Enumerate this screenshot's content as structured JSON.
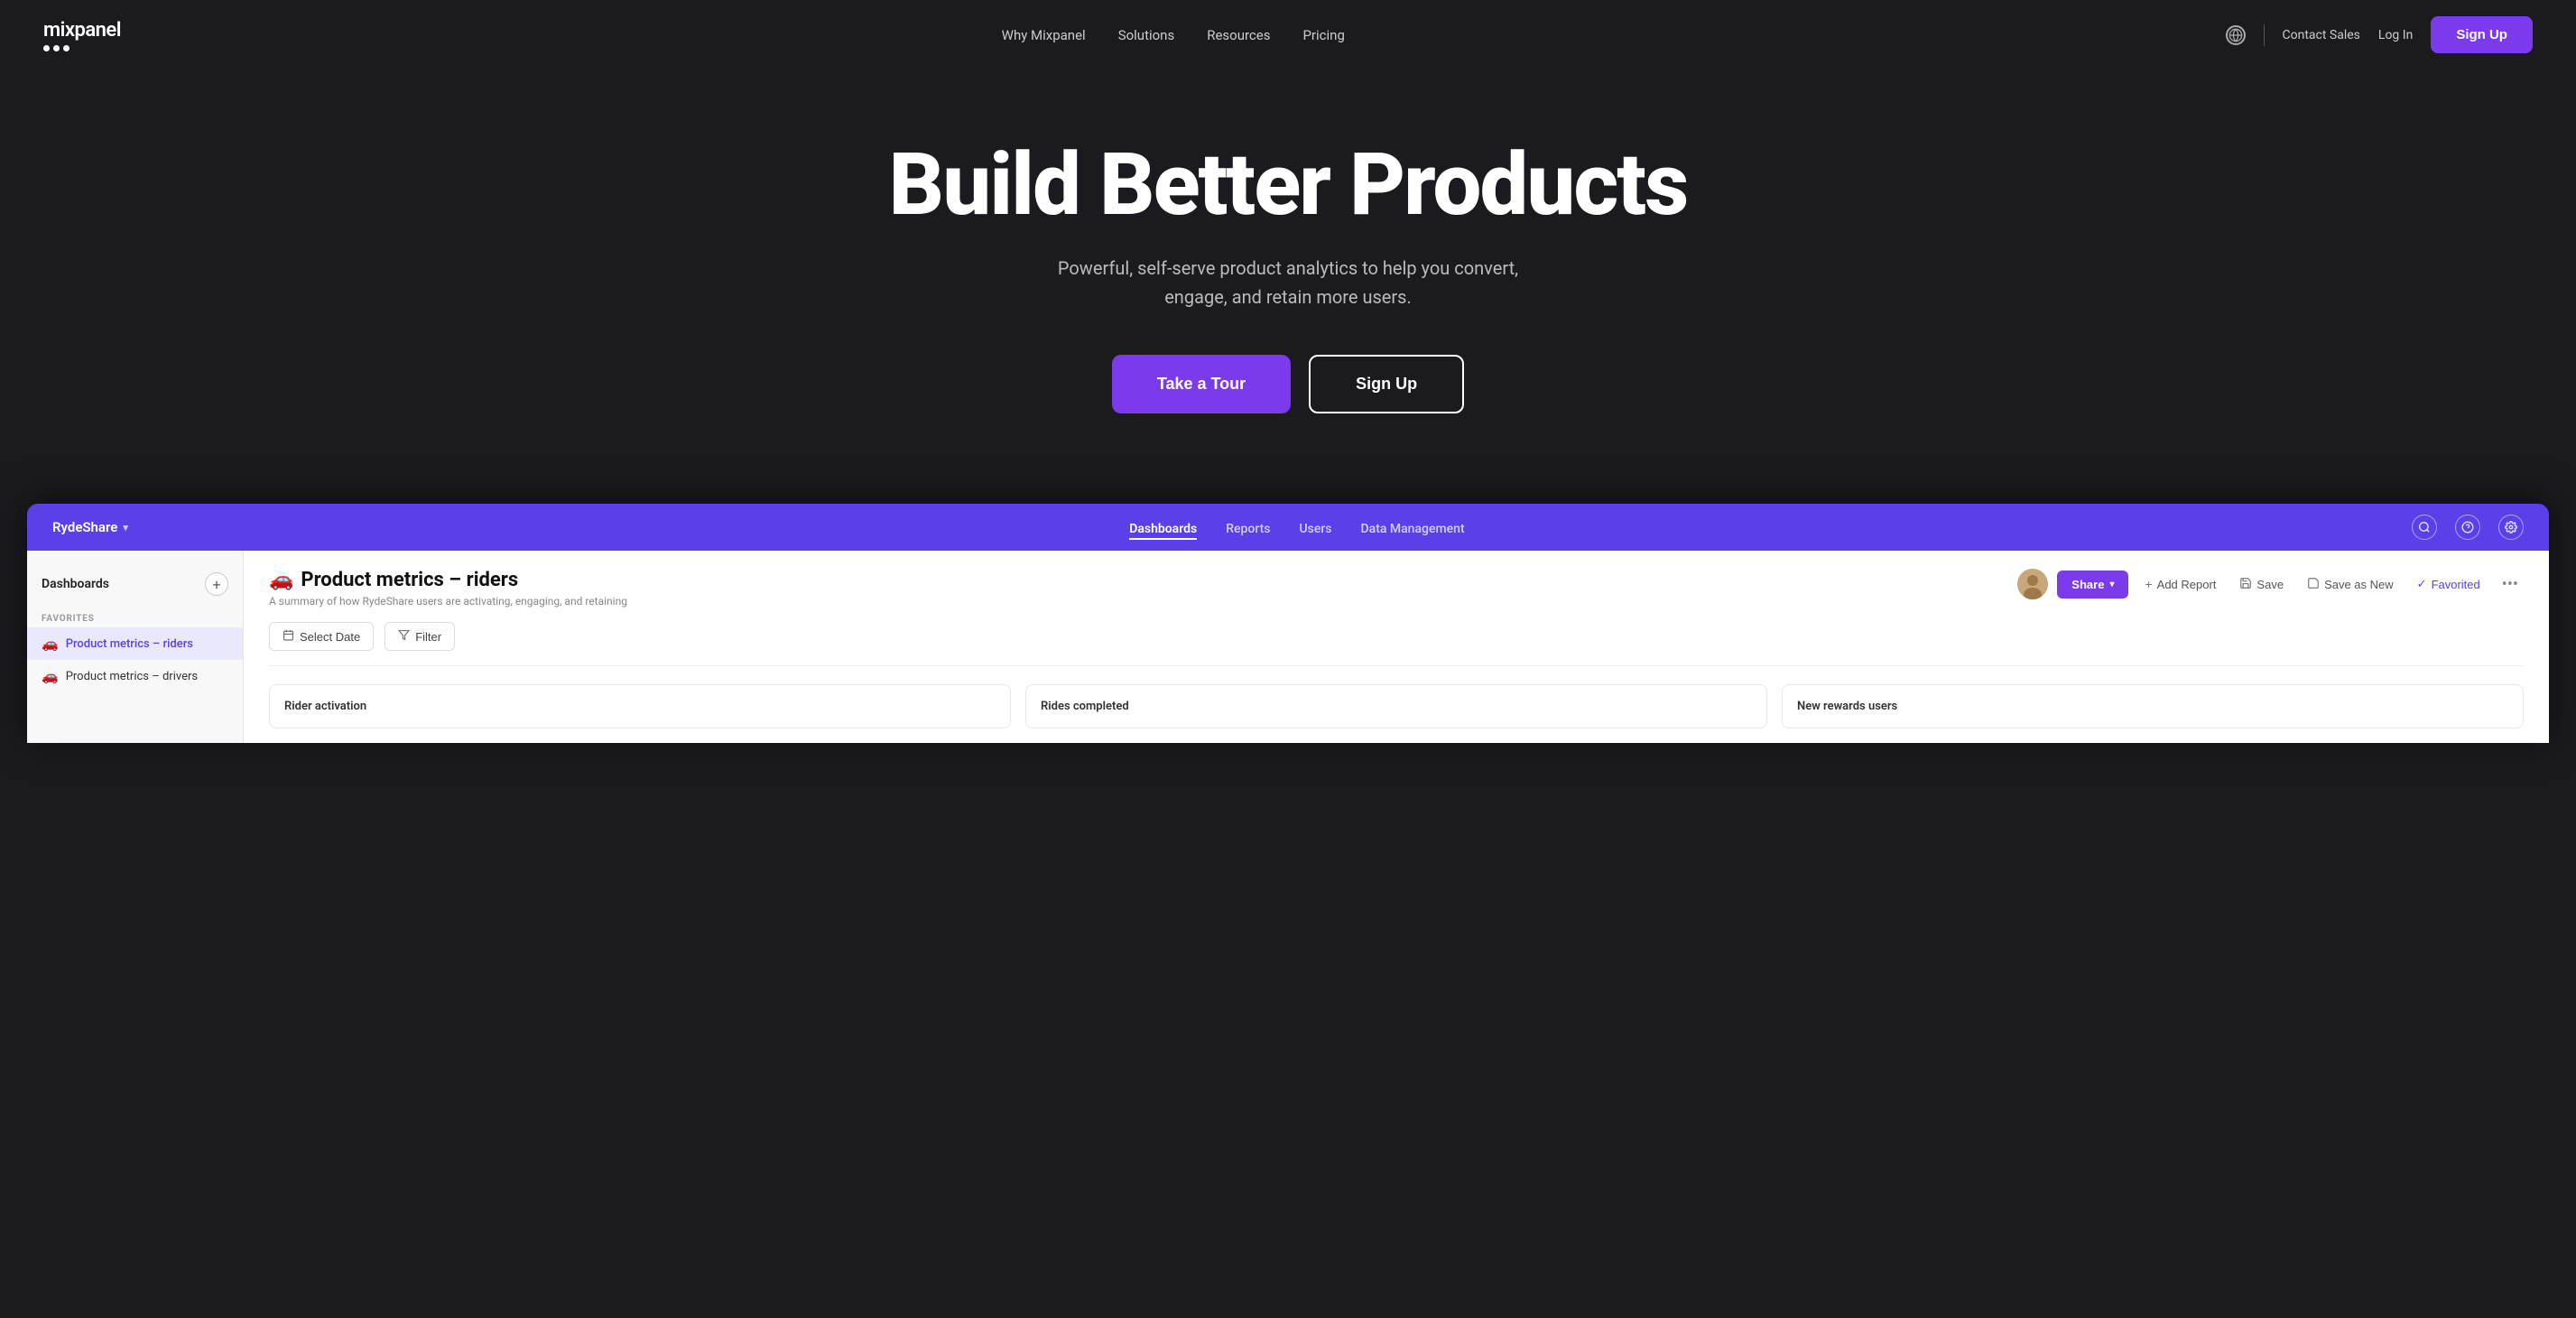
{
  "nav": {
    "logo_text": "mixpanel",
    "links": [
      "Why Mixpanel",
      "Solutions",
      "Resources",
      "Pricing"
    ],
    "contact_label": "Contact Sales",
    "login_label": "Log In",
    "signup_label": "Sign Up",
    "globe_icon": "🌐"
  },
  "hero": {
    "title": "Build Better Products",
    "subtitle_line1": "Powerful, self-serve product analytics to help you convert,",
    "subtitle_line2": "engage, and retain more users.",
    "btn_tour": "Take a Tour",
    "btn_signup": "Sign Up"
  },
  "app": {
    "brand": "RydeShare",
    "nav_links": [
      {
        "label": "Dashboards",
        "active": true
      },
      {
        "label": "Reports",
        "active": false
      },
      {
        "label": "Users",
        "active": false
      },
      {
        "label": "Data Management",
        "active": false
      }
    ],
    "sidebar": {
      "title": "Dashboards",
      "add_icon": "+",
      "section_label": "FAVORITES",
      "items": [
        {
          "icon": "🚗",
          "label": "Product metrics – riders",
          "active": true
        },
        {
          "icon": "🚗",
          "label": "Product metrics – drivers",
          "active": false
        }
      ]
    },
    "dashboard": {
      "title": "Product metrics – riders",
      "title_icon": "🚗",
      "subtitle": "A summary of how RydeShare users are activating, engaging, and retaining",
      "share_label": "Share",
      "add_report_label": "Add Report",
      "save_label": "Save",
      "save_as_new_label": "Save as New",
      "favorited_label": "Favorited",
      "more_icon": "•••",
      "select_date_label": "Select Date",
      "filter_label": "Filter"
    },
    "cards": [
      {
        "title": "Rider activation"
      },
      {
        "title": "Rides completed"
      },
      {
        "title": "New rewards users"
      }
    ],
    "bottom_metrics": [
      {
        "icon": "🚗",
        "label": "Product metrics riders"
      },
      {
        "icon": "🚗",
        "label": "Product metrics drivers"
      }
    ],
    "extra_items": [
      {
        "label": "Rides completed"
      },
      {
        "label": "Select Date"
      }
    ]
  },
  "colors": {
    "purple": "#7c3aed",
    "app_purple": "#5b3fe8",
    "dark_bg": "#1a1a1f",
    "sidebar_bg": "#f8f8f8"
  }
}
